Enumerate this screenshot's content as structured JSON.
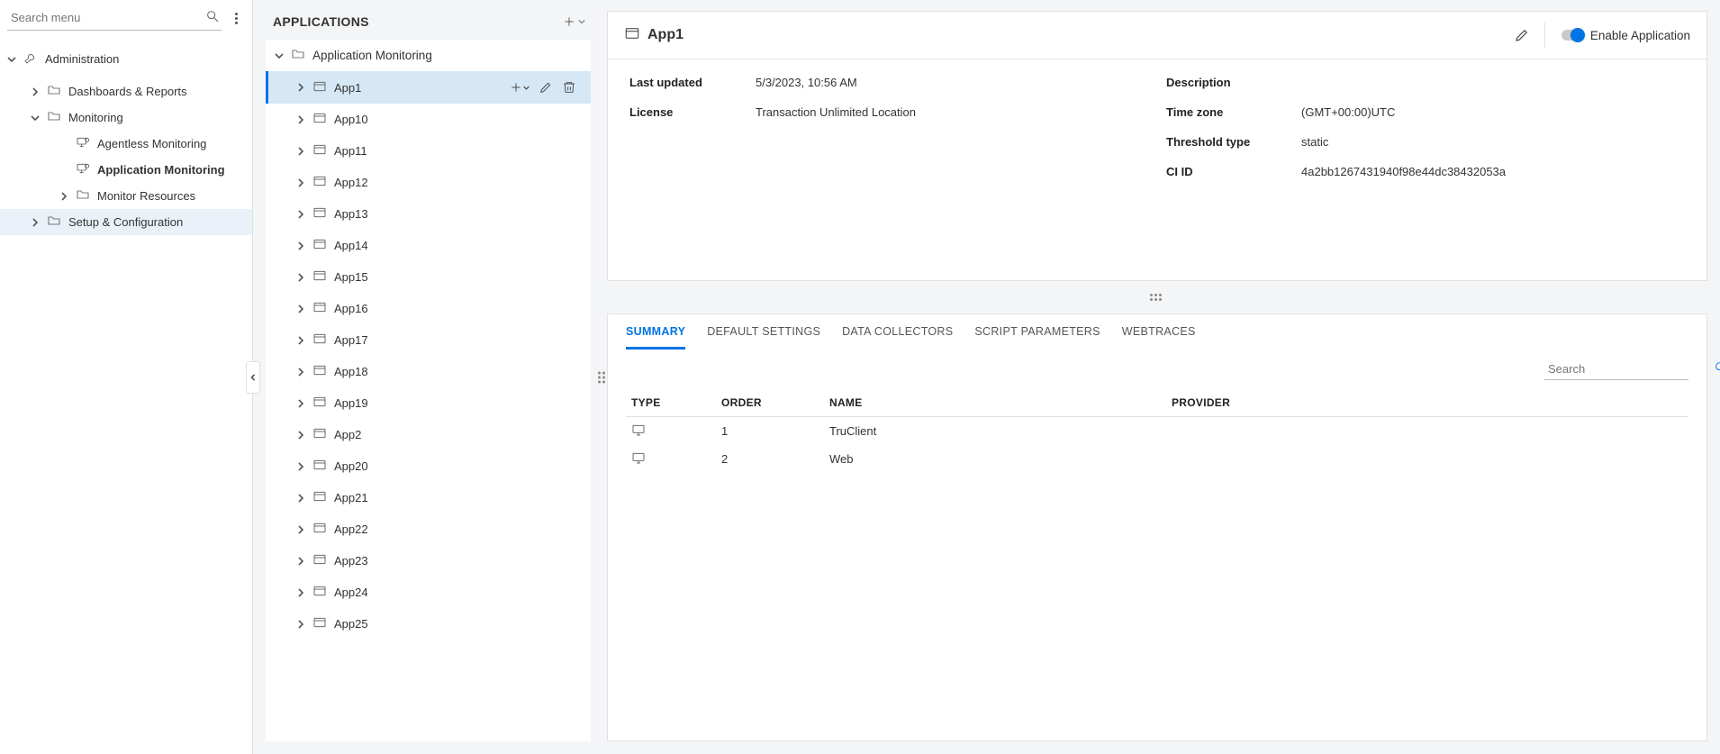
{
  "sidebar": {
    "search_placeholder": "Search menu",
    "root": {
      "label": "Administration"
    },
    "items": [
      {
        "label": "Dashboards & Reports",
        "icon": "folder",
        "expand": "right",
        "indent": 1
      },
      {
        "label": "Monitoring",
        "icon": "folder",
        "expand": "down",
        "indent": 1
      },
      {
        "label": "Agentless Monitoring",
        "icon": "screen",
        "expand": "",
        "indent": 2
      },
      {
        "label": "Application Monitoring",
        "icon": "screen",
        "expand": "",
        "indent": 2,
        "bold": true
      },
      {
        "label": "Monitor Resources",
        "icon": "folder",
        "expand": "right",
        "indent": 2
      },
      {
        "label": "Setup & Configuration",
        "icon": "folder",
        "expand": "right",
        "indent": 1,
        "selected": true
      }
    ]
  },
  "apps": {
    "panel_title": "APPLICATIONS",
    "root": {
      "label": "Application Monitoring"
    },
    "selected_index": 0,
    "items": [
      "App1",
      "App10",
      "App11",
      "App12",
      "App13",
      "App14",
      "App15",
      "App16",
      "App17",
      "App18",
      "App19",
      "App2",
      "App20",
      "App21",
      "App22",
      "App23",
      "App24",
      "App25"
    ]
  },
  "details": {
    "title": "App1",
    "enable_label": "Enable Application",
    "meta": {
      "last_updated_lbl": "Last updated",
      "last_updated_val": "5/3/2023, 10:56 AM",
      "license_lbl": "License",
      "license_val": "Transaction Unlimited Location",
      "description_lbl": "Description",
      "description_val": "",
      "timezone_lbl": "Time zone",
      "timezone_val": "(GMT+00:00)UTC",
      "threshold_lbl": "Threshold type",
      "threshold_val": "static",
      "ciid_lbl": "CI ID",
      "ciid_val": "4a2bb1267431940f98e44dc38432053a"
    },
    "tabs": [
      "SUMMARY",
      "DEFAULT SETTINGS",
      "DATA COLLECTORS",
      "SCRIPT PARAMETERS",
      "WEBTRACES"
    ],
    "table": {
      "search_placeholder": "Search",
      "headers": {
        "type": "TYPE",
        "order": "ORDER",
        "name": "NAME",
        "provider": "PROVIDER"
      },
      "rows": [
        {
          "order": "1",
          "name": "TruClient",
          "provider": ""
        },
        {
          "order": "2",
          "name": "Web",
          "provider": ""
        }
      ]
    }
  }
}
